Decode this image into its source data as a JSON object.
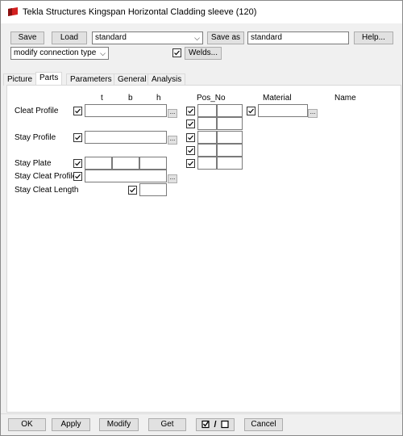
{
  "window": {
    "title": "Tekla Structures  Kingspan Horizontal Cladding sleeve (120)"
  },
  "toolbar": {
    "save_label": "Save",
    "load_label": "Load",
    "preset_value": "standard",
    "save_as_label": "Save as",
    "save_as_value": "standard",
    "help_label": "Help...",
    "mode_value": "modify connection type",
    "welds_label": "Welds..."
  },
  "tabs": [
    {
      "label": "Picture"
    },
    {
      "label": "Parts"
    },
    {
      "label": "Parameters"
    },
    {
      "label": "General"
    },
    {
      "label": "Analysis"
    }
  ],
  "parts": {
    "headers": {
      "t": "t",
      "b": "b",
      "h": "h",
      "pos_no": "Pos_No",
      "material": "Material",
      "name": "Name"
    },
    "rows": [
      {
        "label": "Cleat Profile"
      },
      {
        "label": "Stay Profile"
      },
      {
        "label": "Stay Plate"
      },
      {
        "label": "Stay Cleat Profile"
      },
      {
        "label": "Stay Cleat Length"
      }
    ],
    "ellipsis": "..."
  },
  "footer": {
    "ok_label": "OK",
    "apply_label": "Apply",
    "modify_label": "Modify",
    "get_label": "Get",
    "toggle_label": "/",
    "cancel_label": "Cancel"
  }
}
